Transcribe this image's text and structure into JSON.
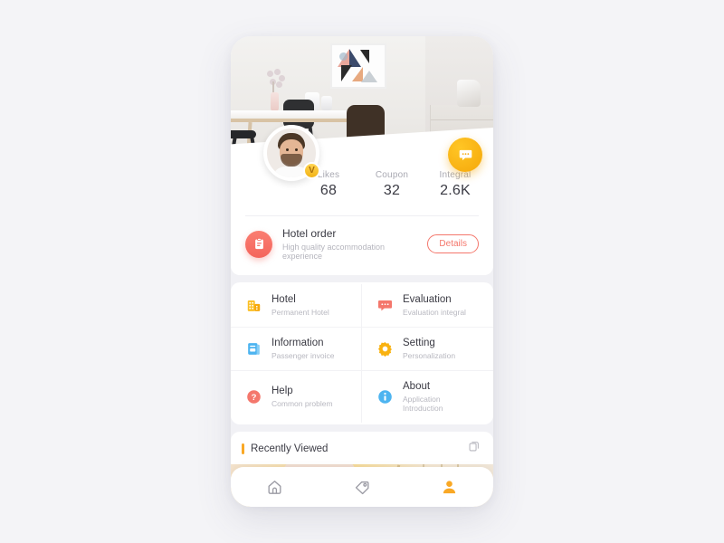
{
  "app": {
    "background_color": "#f4f4f7",
    "card_color": "#ffffff",
    "accent_orange": "#f9a825",
    "accent_red": "#f4776c",
    "accent_blue": "#4db4f0"
  },
  "hero": {
    "photo_alt": "Minimal dining room interior with wooden table, dark chairs, vase and framed geometric art",
    "chat_button": {
      "icon": "chat-bubble-icon",
      "color": "#f5a70a"
    }
  },
  "profile": {
    "avatar": {
      "icon": "user-avatar",
      "alt": "Profile photo of a bearded man in a white shirt"
    },
    "badge": {
      "label": "V",
      "icon": "verified-badge-icon",
      "color": "#f2b316"
    },
    "stats": [
      {
        "label": "Likes",
        "value": "68"
      },
      {
        "label": "Coupon",
        "value": "32"
      },
      {
        "label": "Integral",
        "value": "2.6K"
      }
    ]
  },
  "order": {
    "icon": "clipboard-icon",
    "title": "Hotel order",
    "subtitle": "High quality accommodation experience",
    "button_label": "Details"
  },
  "menu": {
    "items": [
      {
        "icon": "hotel-building-icon",
        "icon_color": "#fbbf24",
        "title": "Hotel",
        "subtitle": "Permanent Hotel"
      },
      {
        "icon": "evaluation-chat-icon",
        "icon_color": "#f4776c",
        "title": "Evaluation",
        "subtitle": "Evaluation integral"
      },
      {
        "icon": "information-invoice-icon",
        "icon_color": "#4db4f0",
        "title": "Information",
        "subtitle": "Passenger invoice"
      },
      {
        "icon": "setting-gear-icon",
        "icon_color": "#f9b211",
        "title": "Setting",
        "subtitle": "Personalization"
      },
      {
        "icon": "help-question-icon",
        "icon_color": "#f4776c",
        "title": "Help",
        "subtitle": "Common problem"
      },
      {
        "icon": "about-info-icon",
        "icon_color": "#4db4f0",
        "title": "About",
        "subtitle": "Application Introduction"
      }
    ]
  },
  "recent": {
    "title": "Recently Viewed",
    "accent_color": "#f9a825",
    "action_icon": "copy-stack-icon",
    "thumbnail_alt": "Warm beige interior room photo with plants and yellow wall"
  },
  "bottom_nav": {
    "items": [
      {
        "icon": "home-icon",
        "active": false
      },
      {
        "icon": "tag-icon",
        "active": false
      },
      {
        "icon": "person-icon",
        "active": true
      }
    ],
    "active_color": "#f9a825",
    "inactive_color": "#9b9ba4"
  }
}
